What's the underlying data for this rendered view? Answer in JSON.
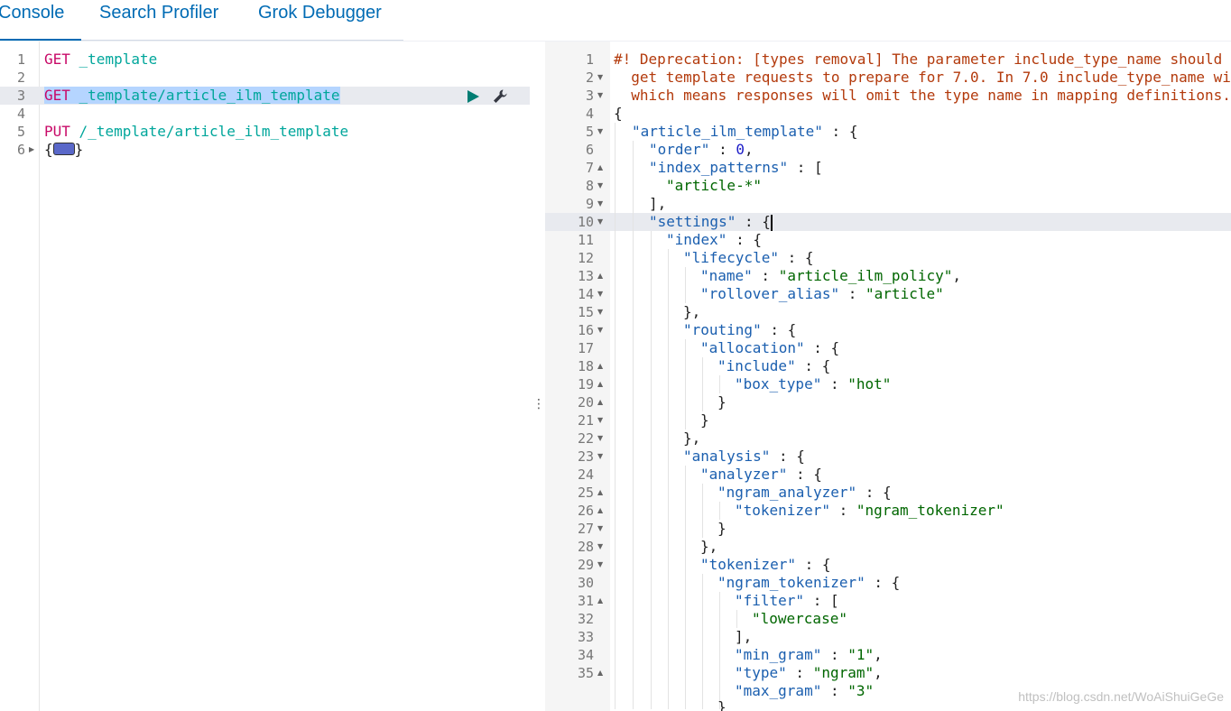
{
  "tabs": [
    {
      "label": "Console",
      "active": true
    },
    {
      "label": "Search Profiler",
      "active": false
    },
    {
      "label": "Grok Debugger",
      "active": false
    }
  ],
  "request_editor": {
    "lines": [
      {
        "n": "1",
        "method": "GET",
        "path": " _template"
      },
      {
        "n": "2",
        "method": "",
        "path": ""
      },
      {
        "n": "3",
        "method": "GET",
        "path": " _template/article_ilm_template",
        "active": true
      },
      {
        "n": "4",
        "method": "",
        "path": ""
      },
      {
        "n": "5",
        "method": "PUT",
        "path": " /_template/article_ilm_template"
      },
      {
        "n": "6",
        "method": "",
        "path": ""
      }
    ]
  },
  "response_editor": {
    "warning_lines": [
      "#! Deprecation: [types removal] The parameter include_type_name should b",
      "  get template requests to prepare for 7.0. In 7.0 include_type_name wil",
      "  which means responses will omit the type name in mapping definitions."
    ],
    "line_numbers": [
      "1",
      "2",
      "3",
      "4",
      "5",
      "6",
      "7",
      "8",
      "9",
      "10",
      "11",
      "12",
      "13",
      "14",
      "15",
      "16",
      "17",
      "18",
      "19",
      "20",
      "21",
      "22",
      "23",
      "24",
      "25",
      "26",
      "27",
      "28",
      "29",
      "30",
      "31",
      "32",
      "33",
      "34",
      "35"
    ],
    "body": {
      "l2": "{",
      "l3_key": "\"article_ilm_template\"",
      "l3_rest": " : {",
      "l4_key": "\"order\"",
      "l4_sep": " : ",
      "l4_val": "0",
      "l4_end": ",",
      "l5_key": "\"index_patterns\"",
      "l5_rest": " : [",
      "l6_val": "\"article-*\"",
      "l7": "],",
      "l8_key": "\"settings\"",
      "l8_rest": " : {",
      "l9_key": "\"index\"",
      "l9_rest": " : {",
      "l10_key": "\"lifecycle\"",
      "l10_rest": " : {",
      "l11_key": "\"name\"",
      "l11_sep": " : ",
      "l11_val": "\"article_ilm_policy\"",
      "l11_end": ",",
      "l12_key": "\"rollover_alias\"",
      "l12_sep": " : ",
      "l12_val": "\"article\"",
      "l13": "},",
      "l14_key": "\"routing\"",
      "l14_rest": " : {",
      "l15_key": "\"allocation\"",
      "l15_rest": " : {",
      "l16_key": "\"include\"",
      "l16_rest": " : {",
      "l17_key": "\"box_type\"",
      "l17_sep": " : ",
      "l17_val": "\"hot\"",
      "l18": "}",
      "l19": "}",
      "l20": "},",
      "l21_key": "\"analysis\"",
      "l21_rest": " : {",
      "l22_key": "\"analyzer\"",
      "l22_rest": " : {",
      "l23_key": "\"ngram_analyzer\"",
      "l23_rest": " : {",
      "l24_key": "\"tokenizer\"",
      "l24_sep": " : ",
      "l24_val": "\"ngram_tokenizer\"",
      "l25": "}",
      "l26": "},",
      "l27_key": "\"tokenizer\"",
      "l27_rest": " : {",
      "l28_key": "\"ngram_tokenizer\"",
      "l28_rest": " : {",
      "l29_key": "\"filter\"",
      "l29_rest": " : [",
      "l30_val": "\"lowercase\"",
      "l31": "],",
      "l32_key": "\"min_gram\"",
      "l32_sep": " : ",
      "l32_val": "\"1\"",
      "l32_end": ",",
      "l33_key": "\"type\"",
      "l33_sep": " : ",
      "l33_val": "\"ngram\"",
      "l33_end": ",",
      "l34_key": "\"max_gram\"",
      "l34_sep": " : ",
      "l34_val": "\"3\"",
      "l35": "}"
    }
  },
  "icons": {
    "run": "play-icon",
    "settings": "wrench-icon",
    "resize": "vertical-ellipsis-icon"
  },
  "resizer_glyph": "⋮",
  "watermark": "https://blog.csdn.net/WoAiShuiGeGe",
  "colors": {
    "accent": "#006bb4",
    "method": "#c80a68",
    "url": "#00a69b",
    "key": "#1b5faf",
    "string": "#006600",
    "number": "#1c1cc8",
    "warning": "#b33a0c",
    "run": "#017d73"
  }
}
